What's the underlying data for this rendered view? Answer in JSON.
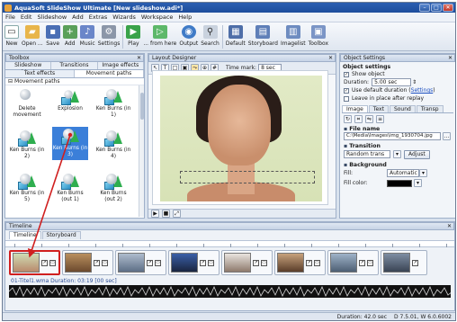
{
  "window": {
    "title": "AquaSoft SlideShow Ultimate [New slideshow.adi*]"
  },
  "menu": [
    "File",
    "Edit",
    "Slideshow",
    "Add",
    "Extras",
    "Wizards",
    "Workspace",
    "Help"
  ],
  "toolbar": {
    "new": "New",
    "open": "Open ...",
    "save": "Save",
    "add": "Add",
    "music": "Music",
    "settings": "Settings",
    "play": "Play",
    "from_here": "... from here",
    "output": "Output",
    "search": "Search",
    "default": "Default",
    "storyboard": "Storyboard",
    "imagelist": "Imagelist",
    "toolbox": "Toolbox"
  },
  "toolbox": {
    "header": "Toolbox",
    "tabs_row1": [
      "Slideshow objects",
      "Transitions",
      "Image effects"
    ],
    "tabs_row2": [
      "Text effects",
      "Movement paths"
    ],
    "group_label": "Movement paths",
    "items": [
      "Delete movement",
      "Explosion",
      "Ken Burns (in 1)",
      "Ken Burns (in 2)",
      "Ken Burns (in 3)",
      "Ken Burns (in 4)",
      "Ken Burns (in 5)",
      "Ken Burns (out 1)",
      "Ken Burns (out 2)"
    ],
    "selected_item": "Ken Burns (in 3)"
  },
  "layout": {
    "header": "Layout Designer",
    "time_mark_label": "Time mark:",
    "time_mark_value": "8 sec"
  },
  "settings": {
    "header": "Object Settings",
    "section": "Object settings",
    "show_object": "Show object",
    "duration_label": "Duration:",
    "duration_value": "5.00 sec",
    "use_default": "Use default duration (",
    "settings_link": "Settings",
    "use_default_end": ")",
    "leave_in_place": "Leave in place after replay",
    "tabs": [
      "Image",
      "Text",
      "Sound",
      "Transp"
    ],
    "file_name_head": "File name",
    "file_path": "C:\\Media\\Images\\img_1930704.jpg",
    "transition_head": "Transition",
    "transition_value": "Random trans",
    "adjust": "Adjust",
    "background_head": "Background",
    "fill_label": "Fill:",
    "fill_value": "Automatic",
    "fill_color_label": "Fill color:"
  },
  "timeline": {
    "header": "Timeline",
    "tabs": [
      "Timeline",
      "Storyboard"
    ],
    "audio_label": "01-Titel1.wma Duration: 03:19 [00 sec]"
  },
  "status": {
    "duration": "Duration: 42.0 sec",
    "version": "D 7.5.01, W 6.0.6002"
  },
  "colors": {
    "title_bar": "#1d4d9c",
    "selection": "#3b7fd9",
    "highlight_red": "#d01f1f"
  }
}
